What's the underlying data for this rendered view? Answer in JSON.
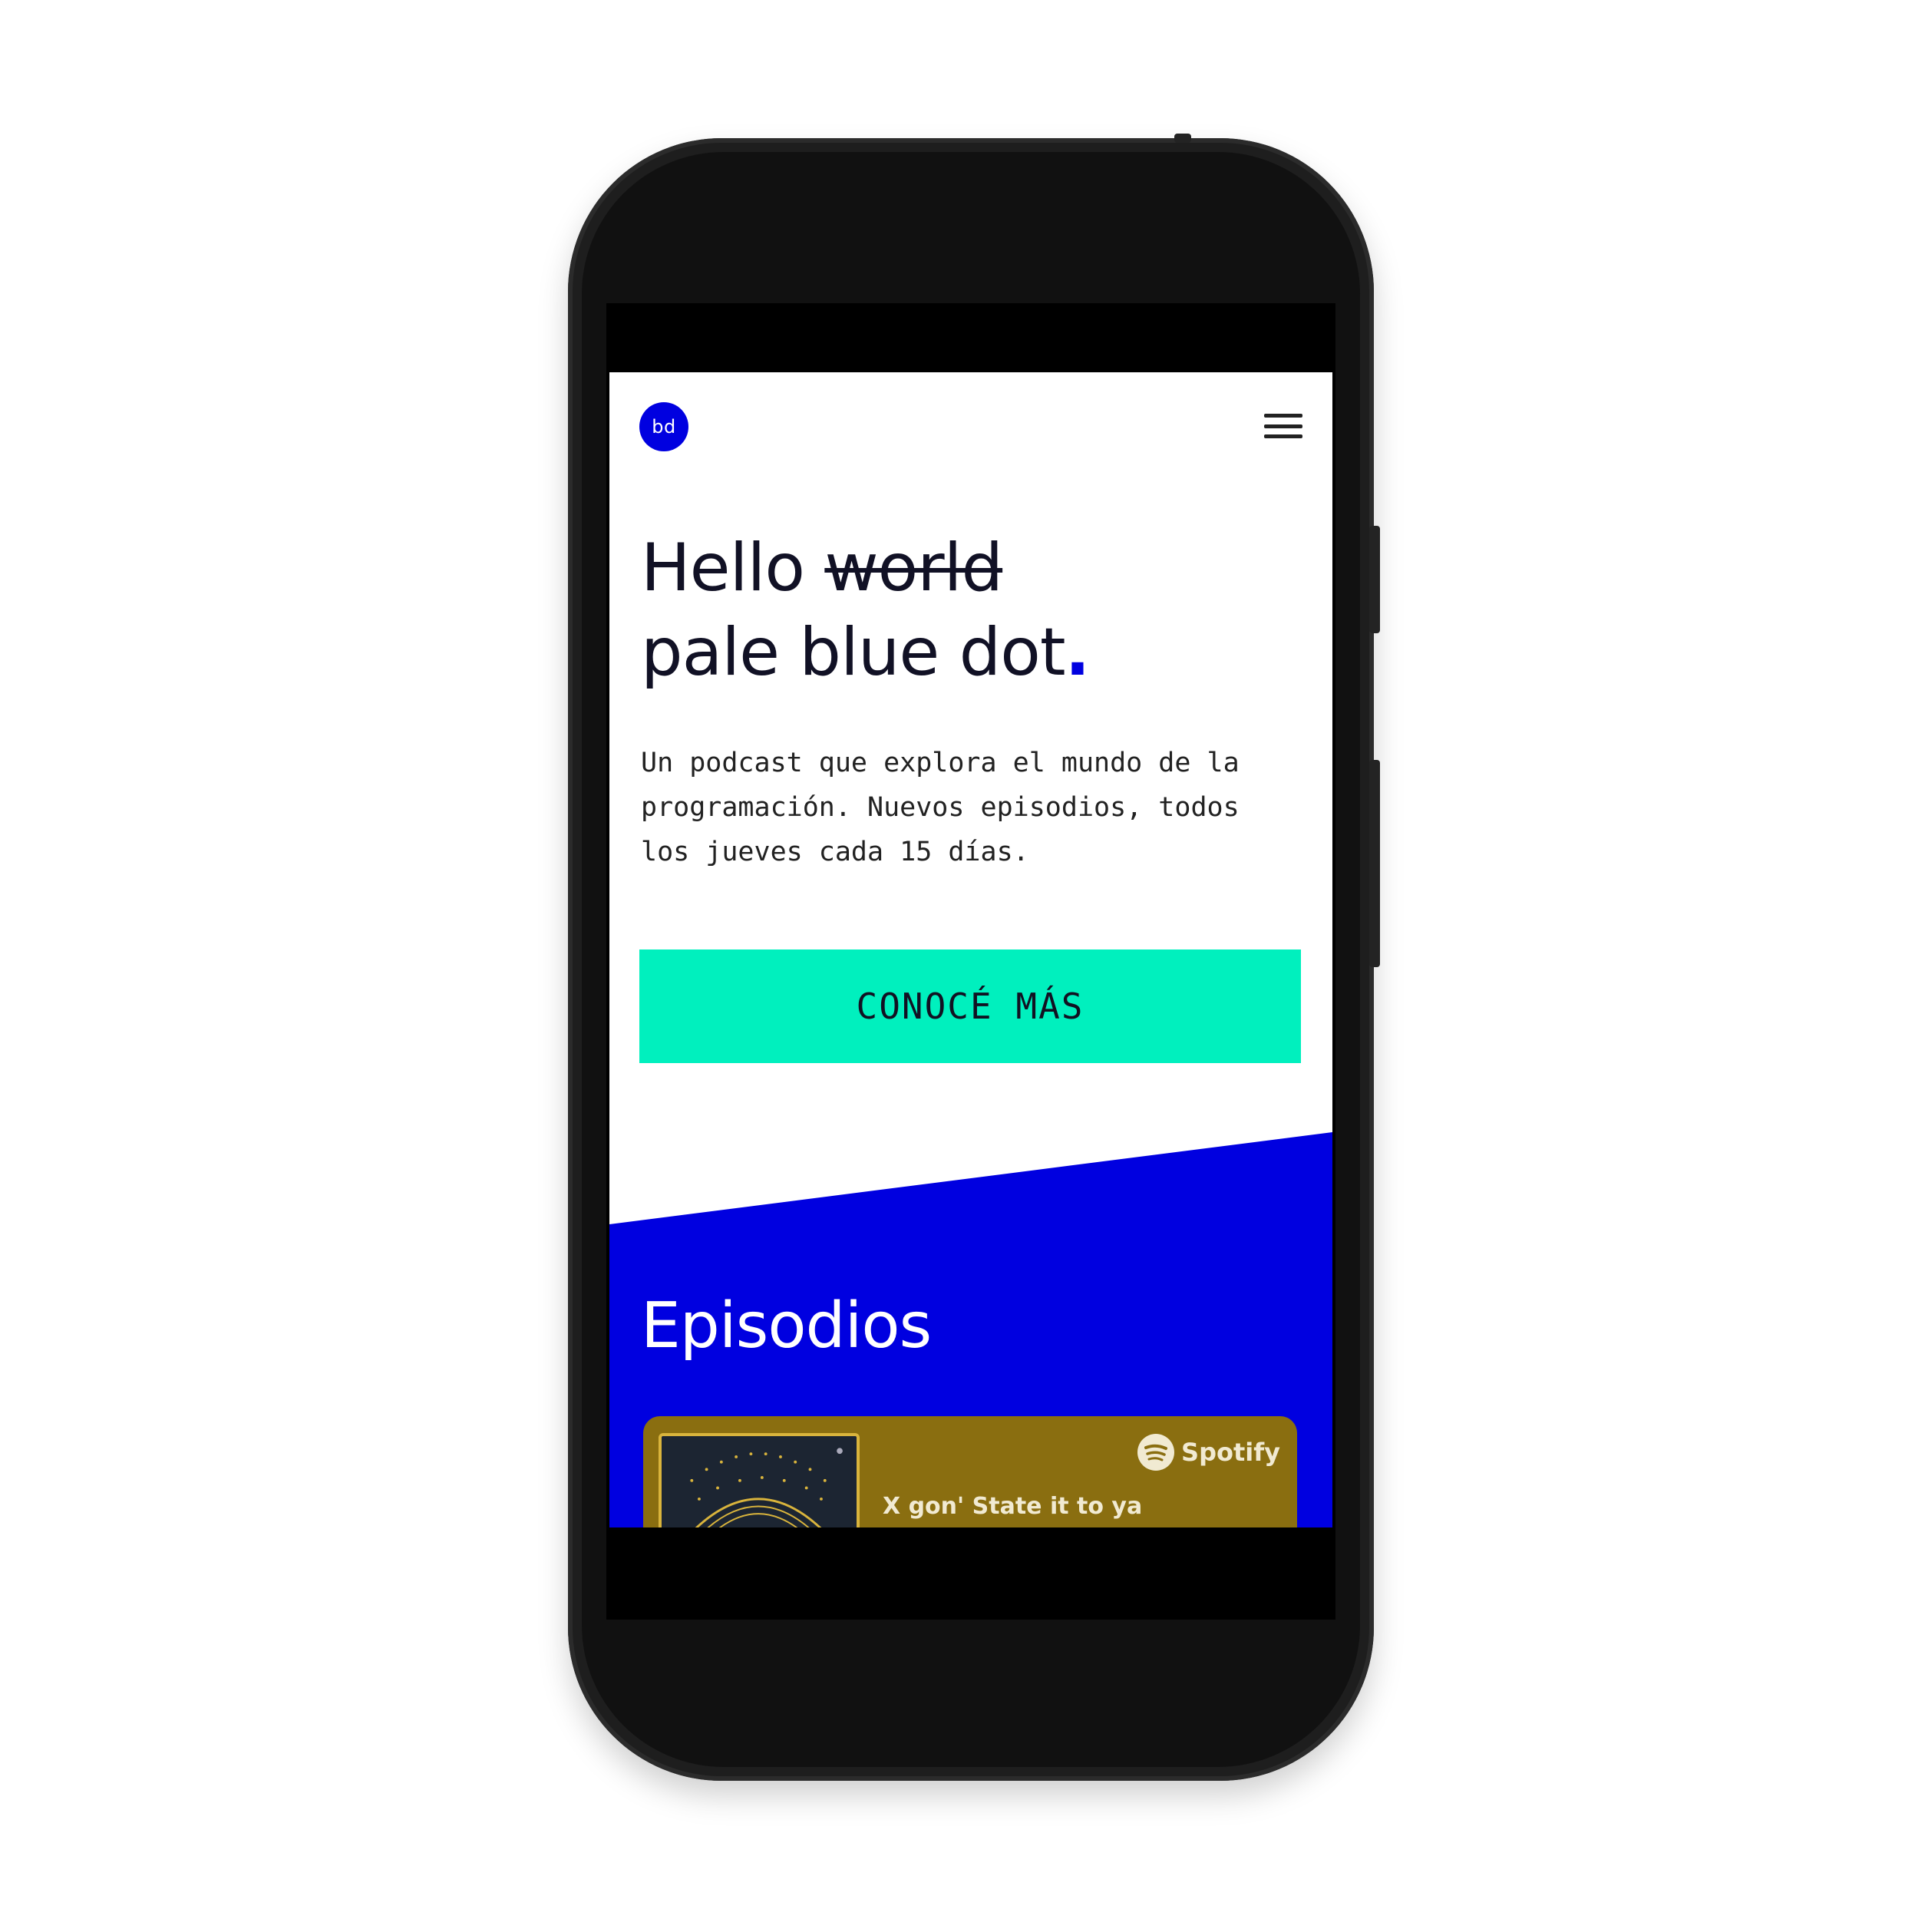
{
  "header": {
    "logo_text": "bd"
  },
  "hero": {
    "title_word1": "Hello",
    "title_struck": "world",
    "title_line2": "pale blue dot",
    "title_dot": ".",
    "description": "Un podcast que explora el mundo de la programación. Nuevos episodios, todos los jueves cada 15 días.",
    "cta_label": "CONOCÉ MÁS"
  },
  "episodes": {
    "heading": "Episodios",
    "card": {
      "provider": "Spotify",
      "title": "X gon' State it to ya"
    }
  },
  "colors": {
    "brand_blue": "#0000e0",
    "cta_green": "#00f0be",
    "card_gold": "#8a6e10",
    "text_dark": "#111125"
  },
  "icons": {
    "menu": "hamburger-menu-icon",
    "spotify": "spotify-logo-icon"
  }
}
